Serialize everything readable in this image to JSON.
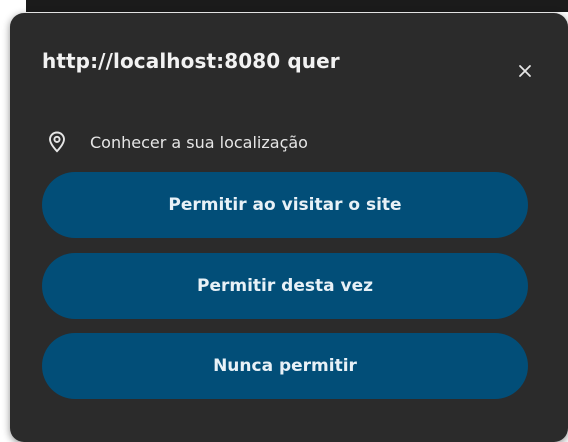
{
  "dialog": {
    "title": "http://localhost:8080 quer",
    "close_icon": "close-icon",
    "permission": {
      "icon": "location-pin-icon",
      "text": "Conhecer a sua localização"
    },
    "buttons": [
      {
        "label": "Permitir ao visitar o site"
      },
      {
        "label": "Permitir desta vez"
      },
      {
        "label": "Nunca permitir"
      }
    ]
  },
  "colors": {
    "popup_background": "#2b2b2b",
    "button_background": "#024e78",
    "text": "#f2f2f2"
  }
}
